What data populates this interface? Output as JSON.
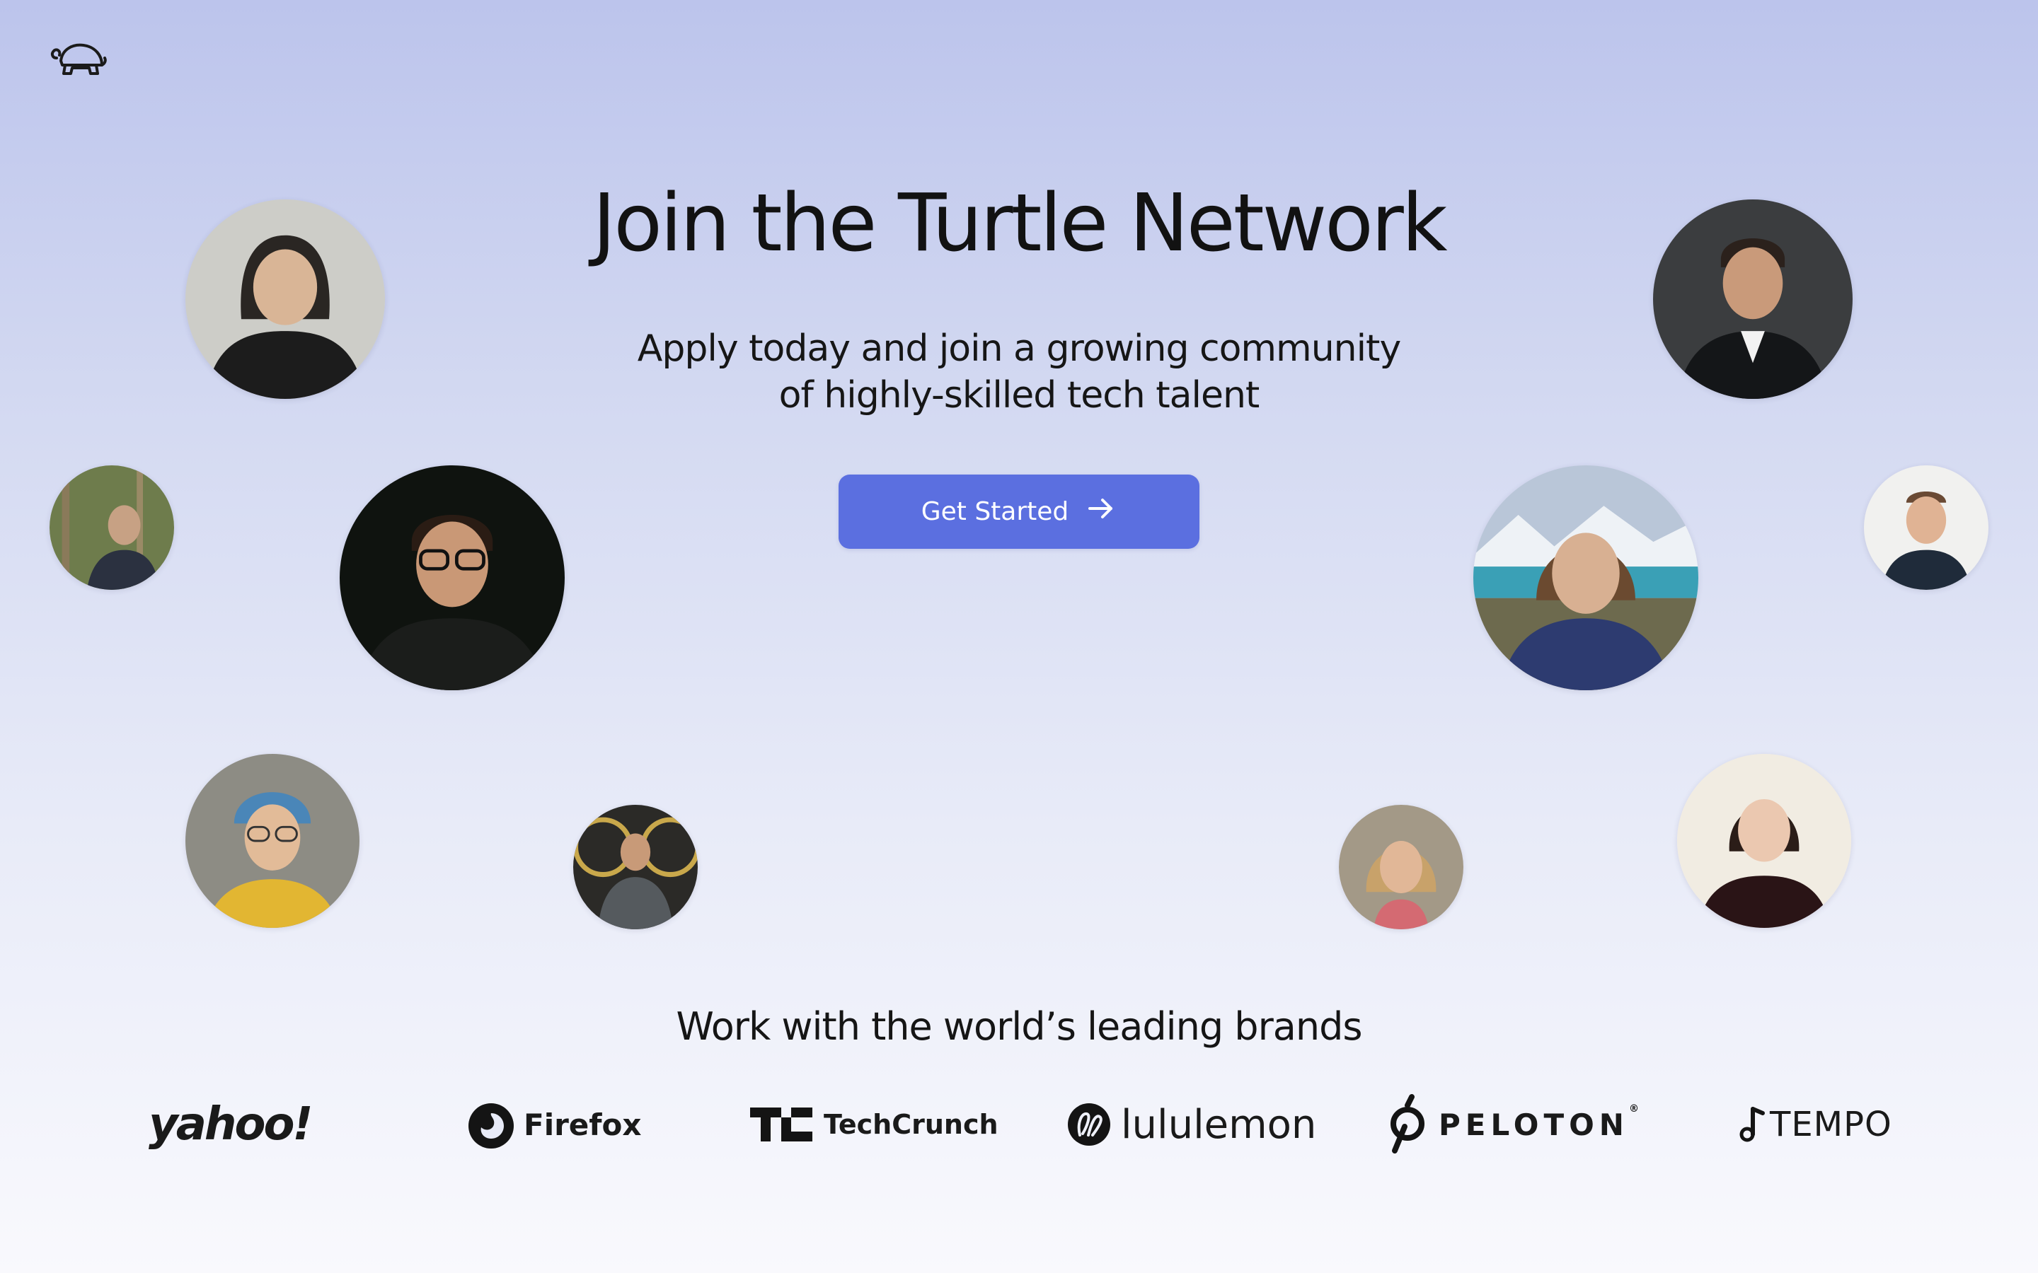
{
  "header": {
    "logo_icon": "turtle-icon"
  },
  "hero": {
    "title": "Join the Turtle Network",
    "subtitle_line1": "Apply today and join a growing community",
    "subtitle_line2": "of highly-skilled tech talent",
    "cta_label": "Get Started",
    "cta_icon": "arrow-right-icon",
    "accent_color": "#5b6fe0"
  },
  "brands": {
    "heading": "Work with the world’s leading brands",
    "items": [
      "yahoo!",
      "Firefox",
      "TechCrunch",
      "lululemon",
      "PELOTON",
      "TEMPO"
    ],
    "peloton_reg": "®"
  }
}
